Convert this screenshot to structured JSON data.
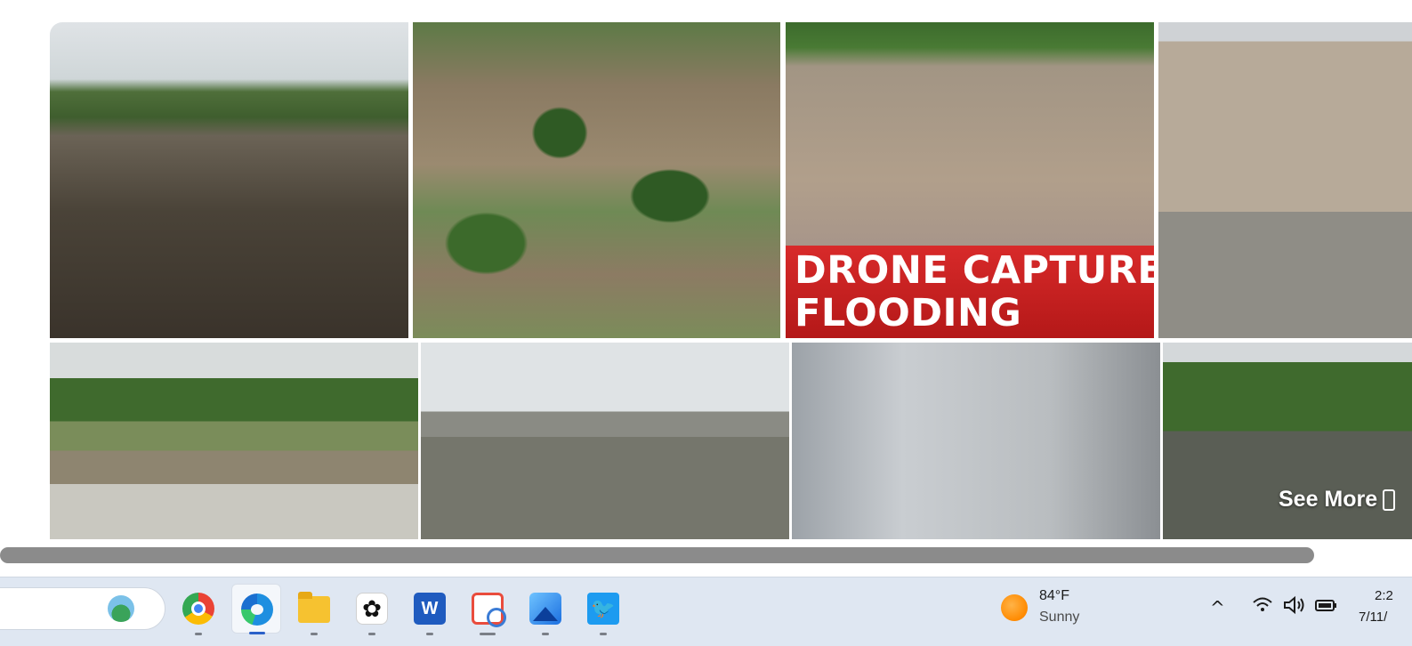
{
  "gallery": {
    "tiles": [
      {
        "name": "flooded-freeway-cars"
      },
      {
        "name": "aerial-flooded-town"
      },
      {
        "name": "drone-flooding-news"
      },
      {
        "name": "flooded-house-porch"
      },
      {
        "name": "flooded-river-bridge"
      },
      {
        "name": "flooded-gas-station"
      },
      {
        "name": "man-with-cowboy-hat"
      },
      {
        "name": "flooded-neighborhood"
      }
    ],
    "drone_banner": {
      "line1": "DRONE CAPTURES",
      "line2": "FLOODING"
    },
    "see_more_label": "See More"
  },
  "taskbar": {
    "apps": [
      {
        "name": "search-box"
      },
      {
        "name": "chrome-icon"
      },
      {
        "name": "edge-icon",
        "active": true
      },
      {
        "name": "file-explorer-icon"
      },
      {
        "name": "chatgpt-icon"
      },
      {
        "name": "word-icon",
        "label": "W"
      },
      {
        "name": "snipping-tool-icon"
      },
      {
        "name": "photos-icon"
      },
      {
        "name": "twitter-icon"
      }
    ],
    "weather": {
      "temp": "84°F",
      "condition": "Sunny"
    },
    "tray": {
      "chevron": "^"
    },
    "clock": {
      "time": "2:2",
      "date": "7/11/"
    }
  },
  "colors": {
    "accent": "#2b61c9",
    "banner_red": "#c41f1f",
    "taskbar_bg": "#dfe7f2",
    "scroll_thumb": "#8b8b8b"
  }
}
